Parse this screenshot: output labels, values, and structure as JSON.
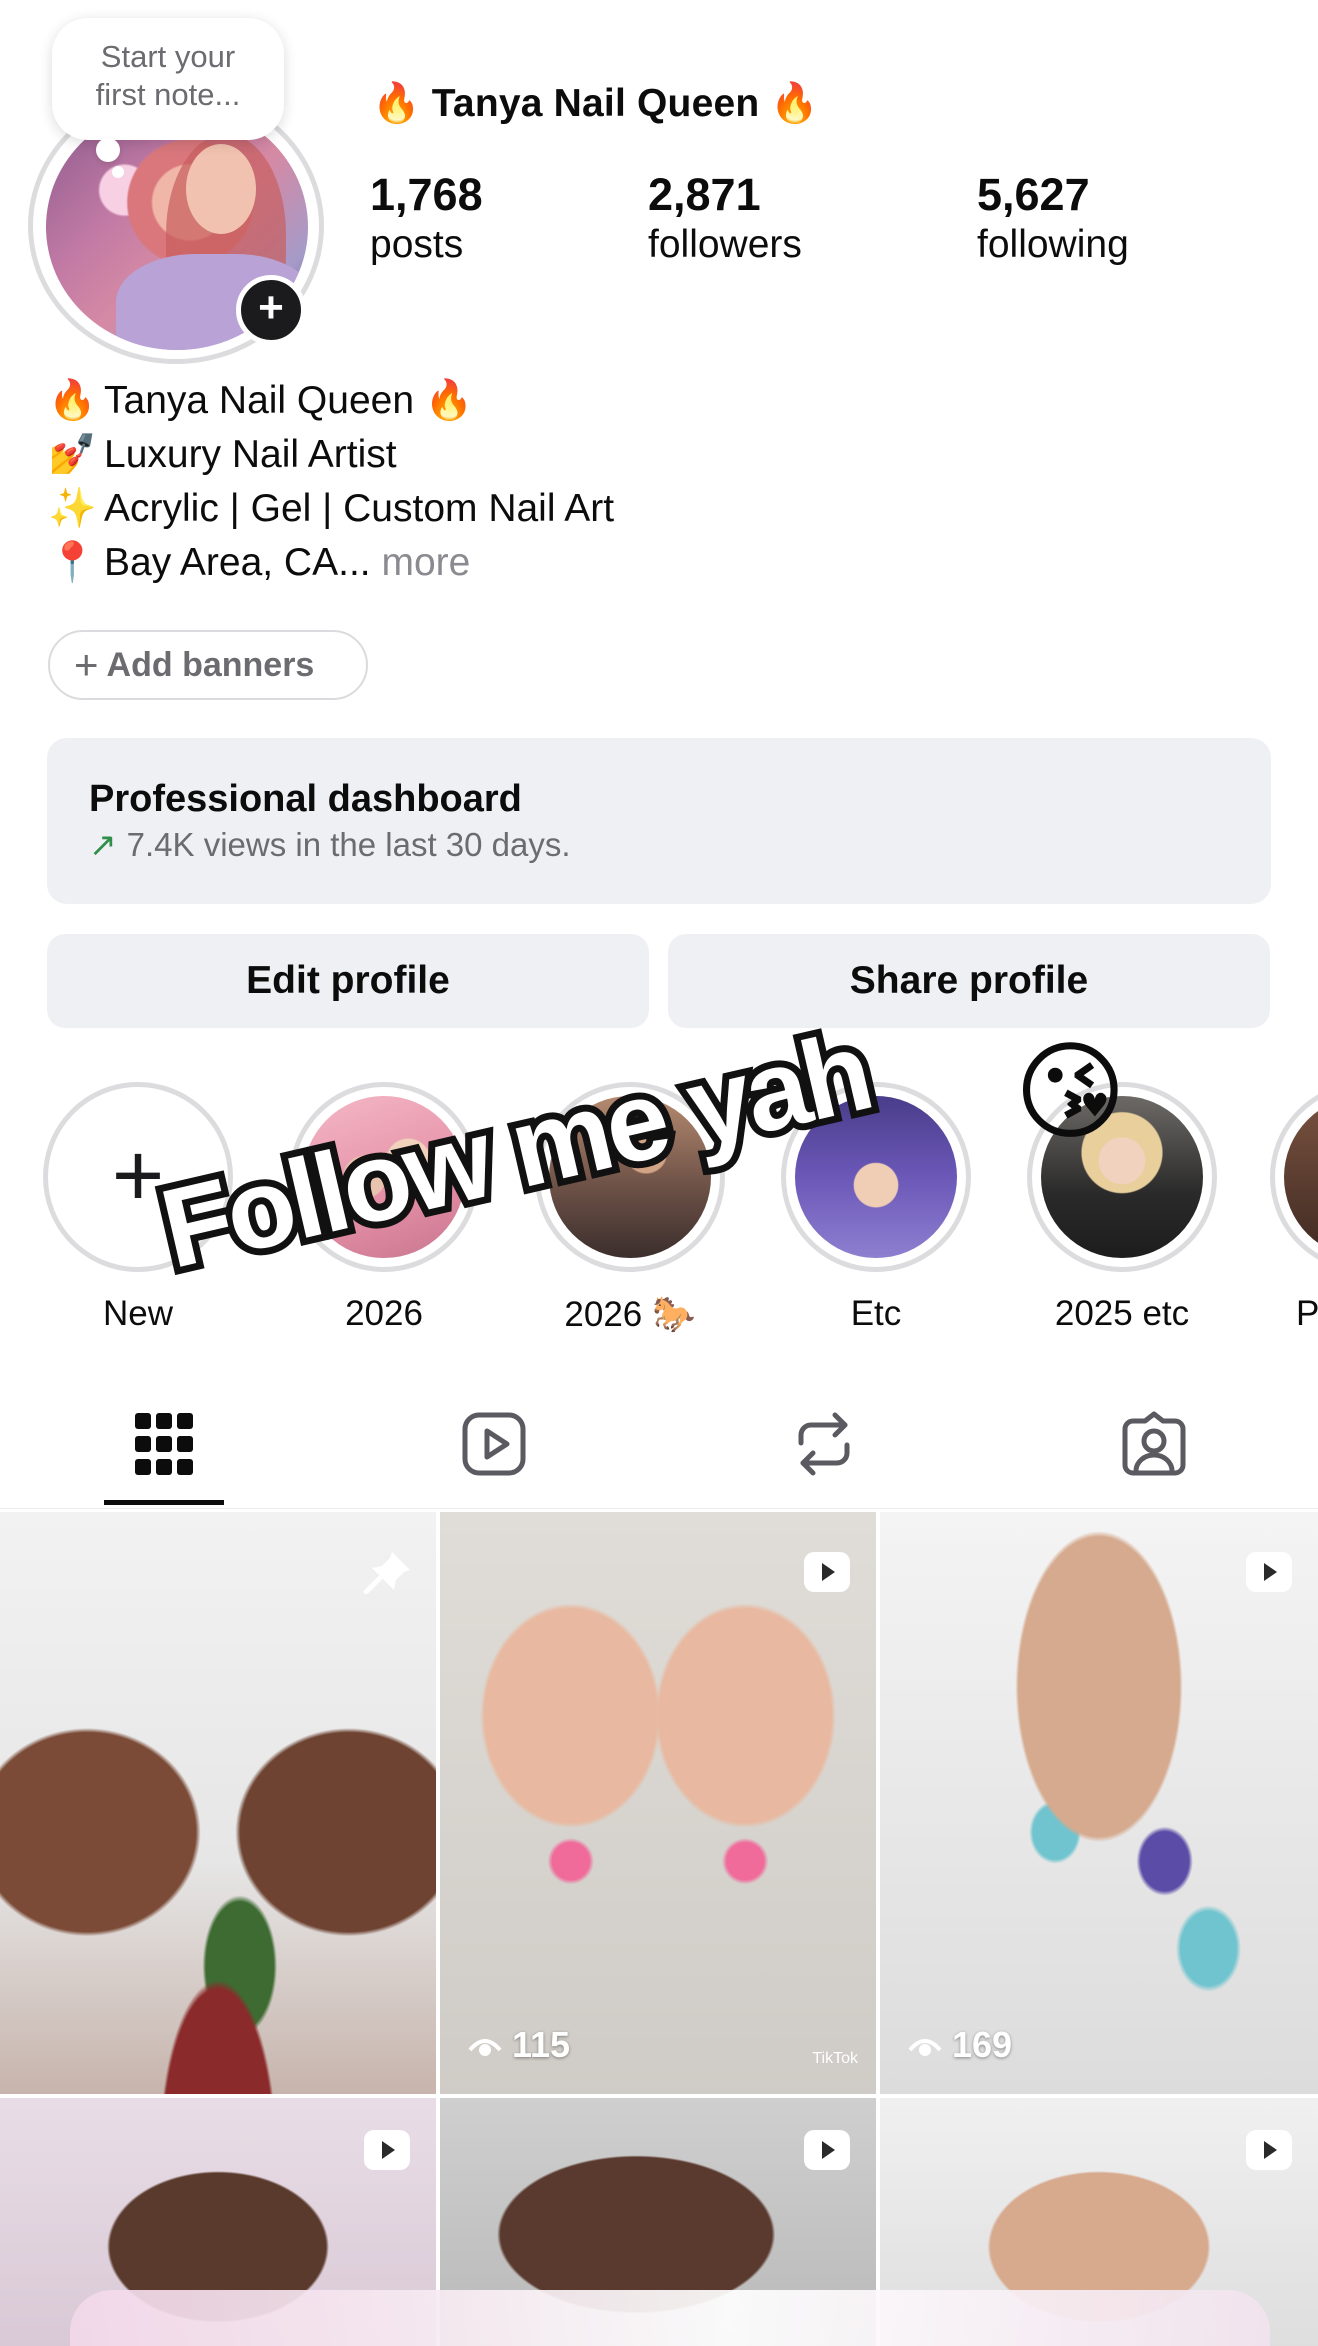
{
  "note": {
    "text_line1": "Start your",
    "text_line2": "first note..."
  },
  "profile": {
    "username": "🔥 Tanya Nail Queen 🔥",
    "stats": [
      {
        "count": "1,768",
        "label": "posts"
      },
      {
        "count": "2,871",
        "label": "followers"
      },
      {
        "count": "5,627",
        "label": "following"
      }
    ],
    "bio": [
      {
        "emoji": "🔥",
        "text": "Tanya Nail Queen  🔥"
      },
      {
        "emoji": "💅",
        "text": "Luxury Nail Artist"
      },
      {
        "emoji": "✨",
        "text": "Acrylic | Gel | Custom Nail Art"
      },
      {
        "emoji": "📍",
        "text": "Bay Area, CA...",
        "more": "more"
      }
    ],
    "add_banners_label": "Add banners"
  },
  "dashboard": {
    "title": "Professional dashboard",
    "arrow": "↗",
    "subtitle": "7.4K views in the last 30 days."
  },
  "actions": {
    "edit_label": "Edit profile",
    "share_label": "Share profile"
  },
  "highlights": [
    {
      "label": "New",
      "kind": "new"
    },
    {
      "label": "2026"
    },
    {
      "label": "2026 🐎"
    },
    {
      "label": "Etc"
    },
    {
      "label": "2025 etc"
    },
    {
      "label": "P"
    }
  ],
  "sticker": {
    "text": "Follow me yah",
    "emoji": "😘"
  },
  "tabs": [
    {
      "name": "grid",
      "icon": "grid-icon",
      "active": true
    },
    {
      "name": "reels",
      "icon": "reels-icon",
      "active": false
    },
    {
      "name": "reposts",
      "icon": "repost-icon",
      "active": false
    },
    {
      "name": "tagged",
      "icon": "tagged-icon",
      "active": false
    }
  ],
  "posts": [
    {
      "type": "pinned",
      "views": ""
    },
    {
      "type": "video",
      "views": "115",
      "watermark": "TikTok"
    },
    {
      "type": "video",
      "views": "169"
    },
    {
      "type": "video",
      "views": ""
    },
    {
      "type": "video",
      "views": ""
    },
    {
      "type": "video",
      "views": ""
    }
  ],
  "colors": {
    "accent_dark": "#0c0c0c",
    "muted_text": "#6b6b70",
    "card_bg": "#eff0f3",
    "trend_green": "#2f8f4a"
  }
}
